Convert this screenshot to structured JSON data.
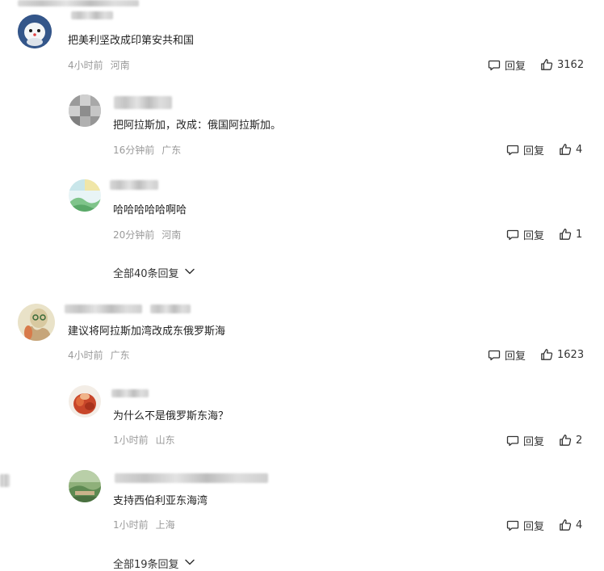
{
  "reply_label": "回复",
  "comments": [
    {
      "text": "把美利坚改成印第安共和国",
      "time": "4小时前",
      "location": "河南",
      "likes": "3162",
      "replies": [
        {
          "text": "把阿拉斯加，改成：俄国阿拉斯加。",
          "time": "16分钟前",
          "location": "广东",
          "likes": "4"
        },
        {
          "text": "哈哈哈哈哈啊哈",
          "time": "20分钟前",
          "location": "河南",
          "likes": "1"
        }
      ],
      "more_replies": "全部40条回复"
    },
    {
      "text": "建议将阿拉斯加湾改成东俄罗斯海",
      "time": "4小时前",
      "location": "广东",
      "likes": "1623",
      "replies": [
        {
          "text": "为什么不是俄罗斯东海？",
          "time": "1小时前",
          "location": "山东",
          "likes": "2"
        },
        {
          "text": "支持西伯利亚东海湾",
          "time": "1小时前",
          "location": "上海",
          "likes": "4"
        }
      ],
      "more_replies": "全部19条回复"
    }
  ]
}
